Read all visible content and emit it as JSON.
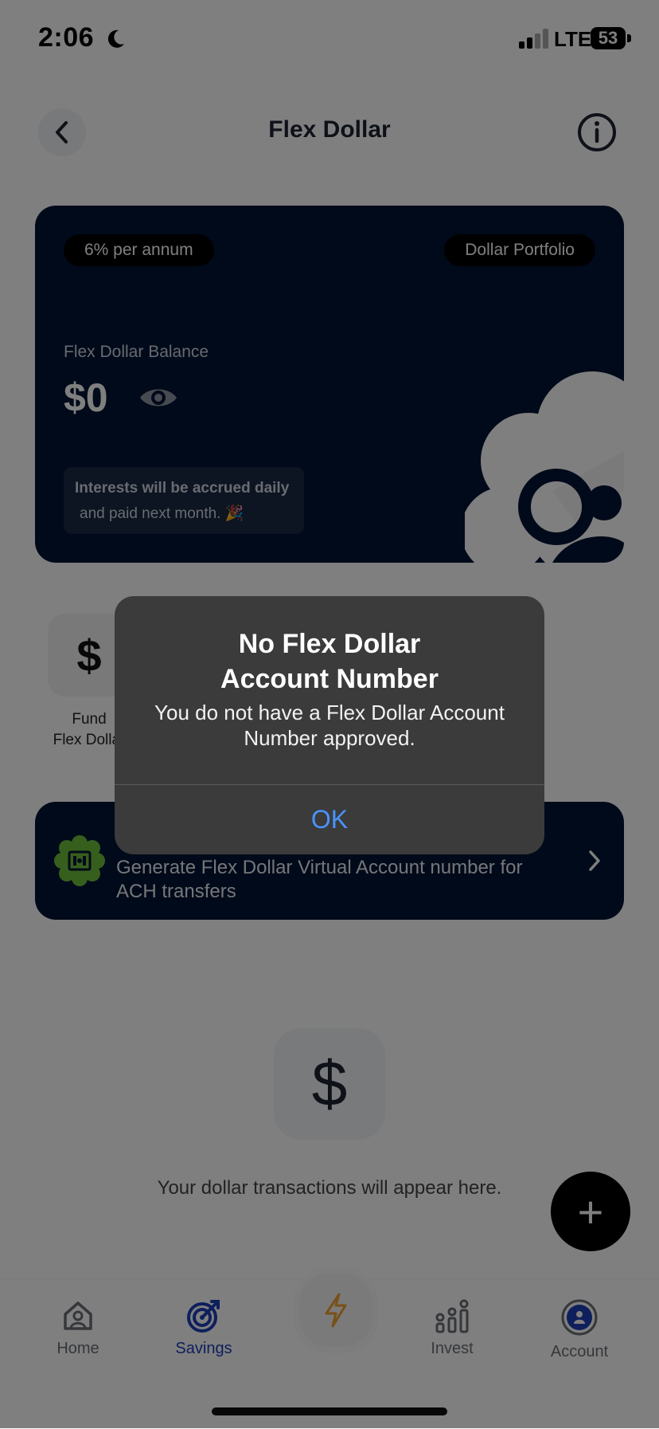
{
  "status_bar": {
    "time": "2:06",
    "network": "LTE",
    "battery": "53"
  },
  "header": {
    "title": "Flex Dollar"
  },
  "card": {
    "rate_badge": "6% per annum",
    "portfolio_badge": "Dollar Portfolio",
    "balance_label": "Flex Dollar Balance",
    "balance_value": "$0",
    "interest_line1": "Interests will be accrued daily",
    "interest_line2": "and paid next month. 🎉"
  },
  "quick_actions": {
    "fund_icon": "$",
    "fund_label_line1": "Fund",
    "fund_label_line2": "Flex Dollar"
  },
  "banner": {
    "text": "Generate Flex Dollar Virtual Account number for ACH transfers"
  },
  "empty_state": {
    "icon": "$",
    "text": "Your dollar transactions will appear here."
  },
  "fab": {
    "label": "+"
  },
  "tabs": [
    {
      "label": "Home",
      "icon": "home-icon",
      "active": false
    },
    {
      "label": "Savings",
      "icon": "target-icon",
      "active": true
    },
    {
      "label": "",
      "icon": "lightning-icon",
      "active": false
    },
    {
      "label": "Invest",
      "icon": "chart-icon",
      "active": false
    },
    {
      "label": "Account",
      "icon": "account-icon",
      "active": false
    }
  ],
  "alert": {
    "title_line1": "No Flex Dollar",
    "title_line2": "Account Number",
    "message": "You do not have a Flex Dollar Account Number approved.",
    "ok_label": "OK"
  },
  "colors": {
    "card_bg": "#031535",
    "accent_blue": "#1c3fb8",
    "ok_blue": "#4a93ff",
    "lightning": "#f0a030"
  }
}
